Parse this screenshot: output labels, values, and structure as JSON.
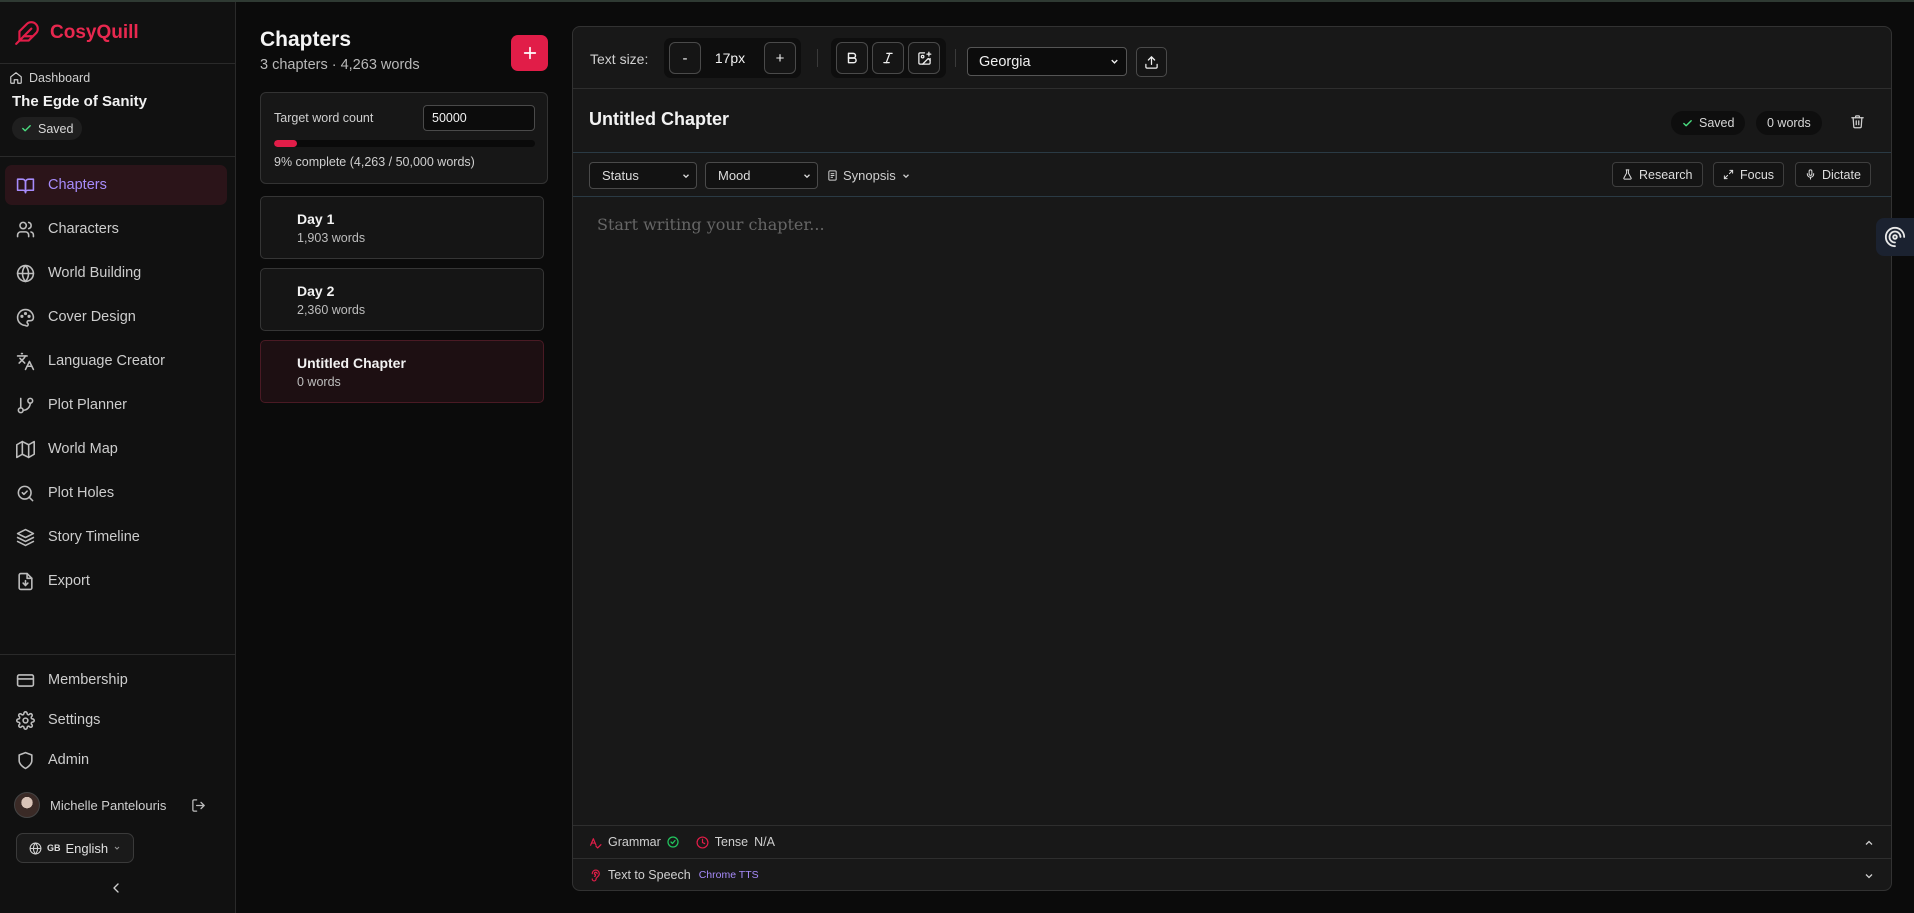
{
  "app": {
    "name": "CosyQuill",
    "brand_color": "#e11d48",
    "accent_color": "#a78bfa"
  },
  "sidebar": {
    "dashboard_label": "Dashboard",
    "project_title": "The Egde of Sanity",
    "saved_label": "Saved",
    "nav": [
      {
        "label": "Chapters",
        "icon": "book-open-icon",
        "active": true
      },
      {
        "label": "Characters",
        "icon": "users-icon"
      },
      {
        "label": "World Building",
        "icon": "globe-icon"
      },
      {
        "label": "Cover Design",
        "icon": "palette-icon"
      },
      {
        "label": "Language Creator",
        "icon": "languages-icon"
      },
      {
        "label": "Plot Planner",
        "icon": "git-branch-icon"
      },
      {
        "label": "World Map",
        "icon": "map-icon"
      },
      {
        "label": "Plot Holes",
        "icon": "search-check-icon"
      },
      {
        "label": "Story Timeline",
        "icon": "layers-icon"
      },
      {
        "label": "Export",
        "icon": "file-download-icon"
      }
    ],
    "bottom_nav": [
      {
        "label": "Membership",
        "icon": "credit-card-icon"
      },
      {
        "label": "Settings",
        "icon": "gear-icon"
      },
      {
        "label": "Admin",
        "icon": "shield-icon"
      }
    ],
    "user_name": "Michelle Pantelouris",
    "language": {
      "flag": "GB",
      "label": "English"
    }
  },
  "chapters_panel": {
    "title": "Chapters",
    "summary": "3 chapters · 4,263 words",
    "target_label": "Target word count",
    "target_value": "50000",
    "progress_fraction": 0.09,
    "progress_text": "9% complete (4,263 / 50,000 words)",
    "chapters": [
      {
        "name": "Day 1",
        "words": "1,903 words",
        "active": false
      },
      {
        "name": "Day 2",
        "words": "2,360 words",
        "active": false
      },
      {
        "name": "Untitled Chapter",
        "words": "0 words",
        "active": true
      }
    ]
  },
  "editor": {
    "text_size_label": "Text size:",
    "decrease_label": "-",
    "size_value": "17px",
    "increase_label": "+",
    "font_value": "Georgia",
    "chapter_title": "Untitled Chapter",
    "saved_label": "Saved",
    "word_count": "0 words",
    "status_placeholder": "Status",
    "mood_placeholder": "Mood",
    "synopsis_label": "Synopsis",
    "research_label": "Research",
    "focus_label": "Focus",
    "dictate_label": "Dictate",
    "placeholder": "Start writing your chapter...",
    "grammar_label": "Grammar",
    "tense_label": "Tense",
    "tense_value": "N/A",
    "tts_label": "Text to Speech",
    "tts_engine": "Chrome TTS"
  }
}
